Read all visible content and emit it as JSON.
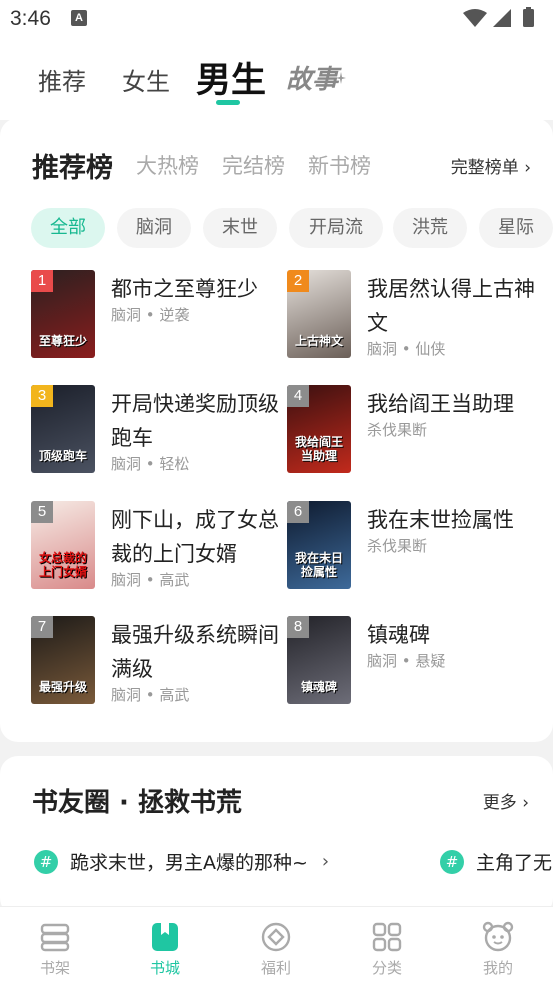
{
  "status": {
    "time": "3:46",
    "indicator": "A"
  },
  "top_tabs": [
    {
      "label": "推荐"
    },
    {
      "label": "女生"
    },
    {
      "label": "男生"
    },
    {
      "label": "故事"
    }
  ],
  "ranking": {
    "tabs": [
      {
        "label": "推荐榜"
      },
      {
        "label": "大热榜"
      },
      {
        "label": "完结榜"
      },
      {
        "label": "新书榜"
      }
    ],
    "full_link": "完整榜单 ›",
    "chips": [
      {
        "label": "全部"
      },
      {
        "label": "脑洞"
      },
      {
        "label": "末世"
      },
      {
        "label": "开局流"
      },
      {
        "label": "洪荒"
      },
      {
        "label": "星际"
      }
    ],
    "books": [
      {
        "rank": "1",
        "title": "都市之至尊狂少",
        "meta": "脑洞 • 逆袭",
        "cover_text": "至尊狂少",
        "badge_color": "#e94b4b",
        "cover_colors": [
          "#2b2020",
          "#8a1d1d"
        ]
      },
      {
        "rank": "2",
        "title": "我居然认得上古神文",
        "meta": "脑洞 • 仙侠",
        "cover_text": "上古神文",
        "badge_color": "#f08a1c",
        "cover_colors": [
          "#e6e1dc",
          "#6b5f58"
        ]
      },
      {
        "rank": "3",
        "title": "开局快递奖励顶级跑车",
        "meta": "脑洞 • 轻松",
        "cover_text": "顶级跑车",
        "badge_color": "#f2b51d",
        "cover_colors": [
          "#1b1f2a",
          "#4b5261"
        ]
      },
      {
        "rank": "4",
        "title": "我给阎王当助理",
        "meta": "杀伐果断",
        "cover_text": "我给阎王当助理",
        "badge_color": "#8c8c8c",
        "cover_colors": [
          "#3a1010",
          "#c22a1c"
        ]
      },
      {
        "rank": "5",
        "title": "刚下山，成了女总裁的上门女婿",
        "meta": "脑洞 • 高武",
        "cover_text": "女总裁的上门女婿",
        "badge_color": "#8c8c8c",
        "cover_colors": [
          "#f6ece6",
          "#d98a8a"
        ]
      },
      {
        "rank": "6",
        "title": "我在末世捡属性",
        "meta": "杀伐果断",
        "cover_text": "我在末日捡属性",
        "badge_color": "#8c8c8c",
        "cover_colors": [
          "#0e1a2e",
          "#3e6a9a"
        ]
      },
      {
        "rank": "7",
        "title": "最强升级系统瞬间满级",
        "meta": "脑洞 • 高武",
        "cover_text": "最强升级",
        "badge_color": "#8c8c8c",
        "cover_colors": [
          "#1c1a18",
          "#7a5a3a"
        ]
      },
      {
        "rank": "8",
        "title": "镇魂碑",
        "meta": "脑洞 • 悬疑",
        "cover_text": "镇魂碑",
        "badge_color": "#8c8c8c",
        "cover_colors": [
          "#222228",
          "#6d6d78"
        ]
      }
    ]
  },
  "community": {
    "title": "书友圈 · 拯救书荒",
    "more": "更多 ›",
    "topics": [
      {
        "text": "跪求末世，男主A爆的那种~",
        "arrow": "›"
      },
      {
        "text": "主角了无",
        "arrow": ""
      }
    ]
  },
  "bottom_nav": [
    {
      "label": "书架",
      "icon": "bookshelf-icon"
    },
    {
      "label": "书城",
      "icon": "bookstore-icon"
    },
    {
      "label": "福利",
      "icon": "welfare-icon"
    },
    {
      "label": "分类",
      "icon": "category-icon"
    },
    {
      "label": "我的",
      "icon": "profile-icon"
    }
  ],
  "colors": {
    "accent": "#1fc6a2"
  }
}
